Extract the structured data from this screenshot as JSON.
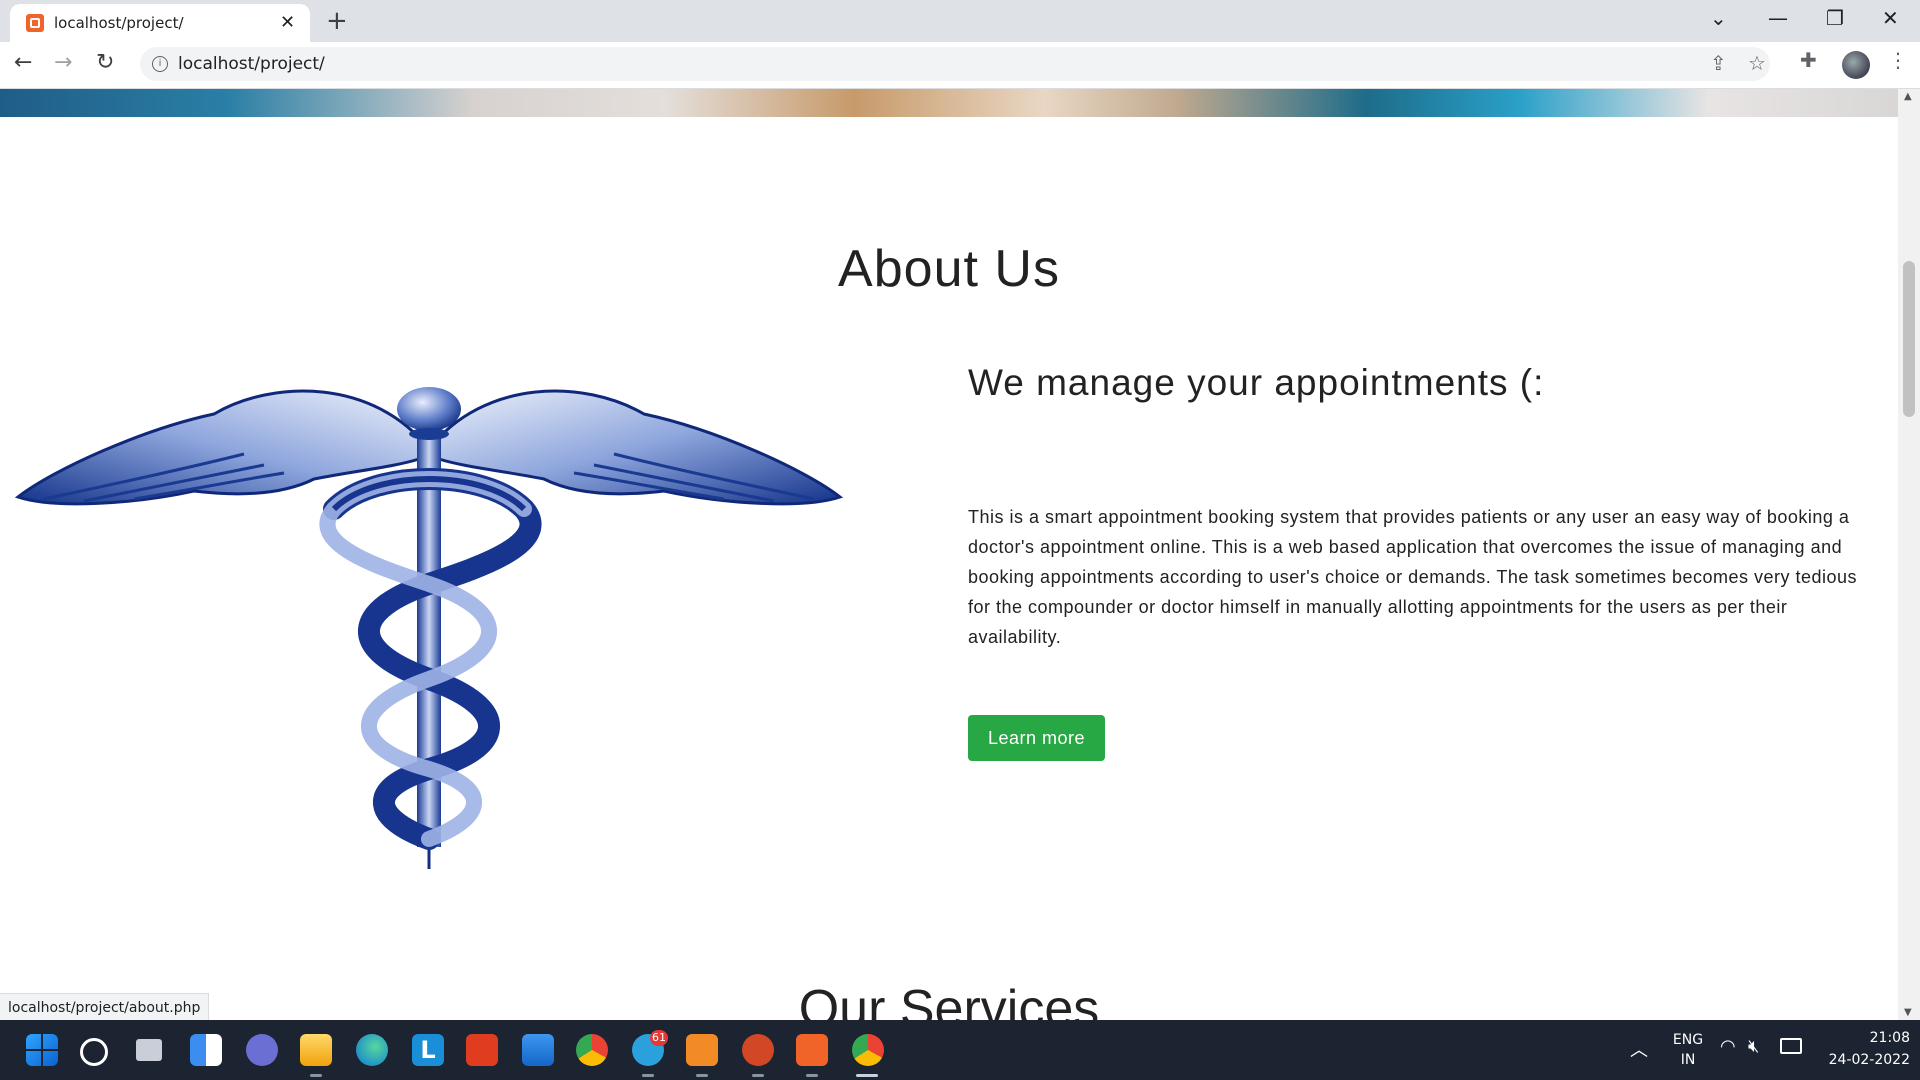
{
  "browser": {
    "tab_title": "localhost/project/",
    "url": "localhost/project/",
    "status_url": "localhost/project/about.php",
    "new_tab_symbol": "+",
    "tab_close_symbol": "✕"
  },
  "page": {
    "about_title": "About Us",
    "about_heading": "We manage your appointments (:",
    "about_text": "This is a smart appointment booking system that provides patients or any user an easy way of booking a doctor's appointment online. This is a web based application that overcomes the issue of managing and booking appointments according to user's choice or demands. The task sometimes becomes very tedious for the compounder or doctor himself in manually allotting appointments for the users as per their availability.",
    "learn_more_label": "Learn more",
    "services_title": "Our Services",
    "accent_color": "#28a745"
  },
  "taskbar": {
    "telegram_badge": "61",
    "lang_top": "ENG",
    "lang_bottom": "IN",
    "time": "21:08",
    "date": "24-02-2022",
    "pinned_icons": [
      "windows-start-icon",
      "search-icon",
      "task-view-icon",
      "widgets-icon",
      "teams-chat-icon",
      "file-explorer-icon",
      "edge-icon",
      "lucid-icon",
      "office-icon",
      "mail-icon",
      "chrome-icon",
      "telegram-icon",
      "sublime-text-icon",
      "powerpoint-icon",
      "xampp-icon",
      "chrome-profile-icon"
    ]
  }
}
